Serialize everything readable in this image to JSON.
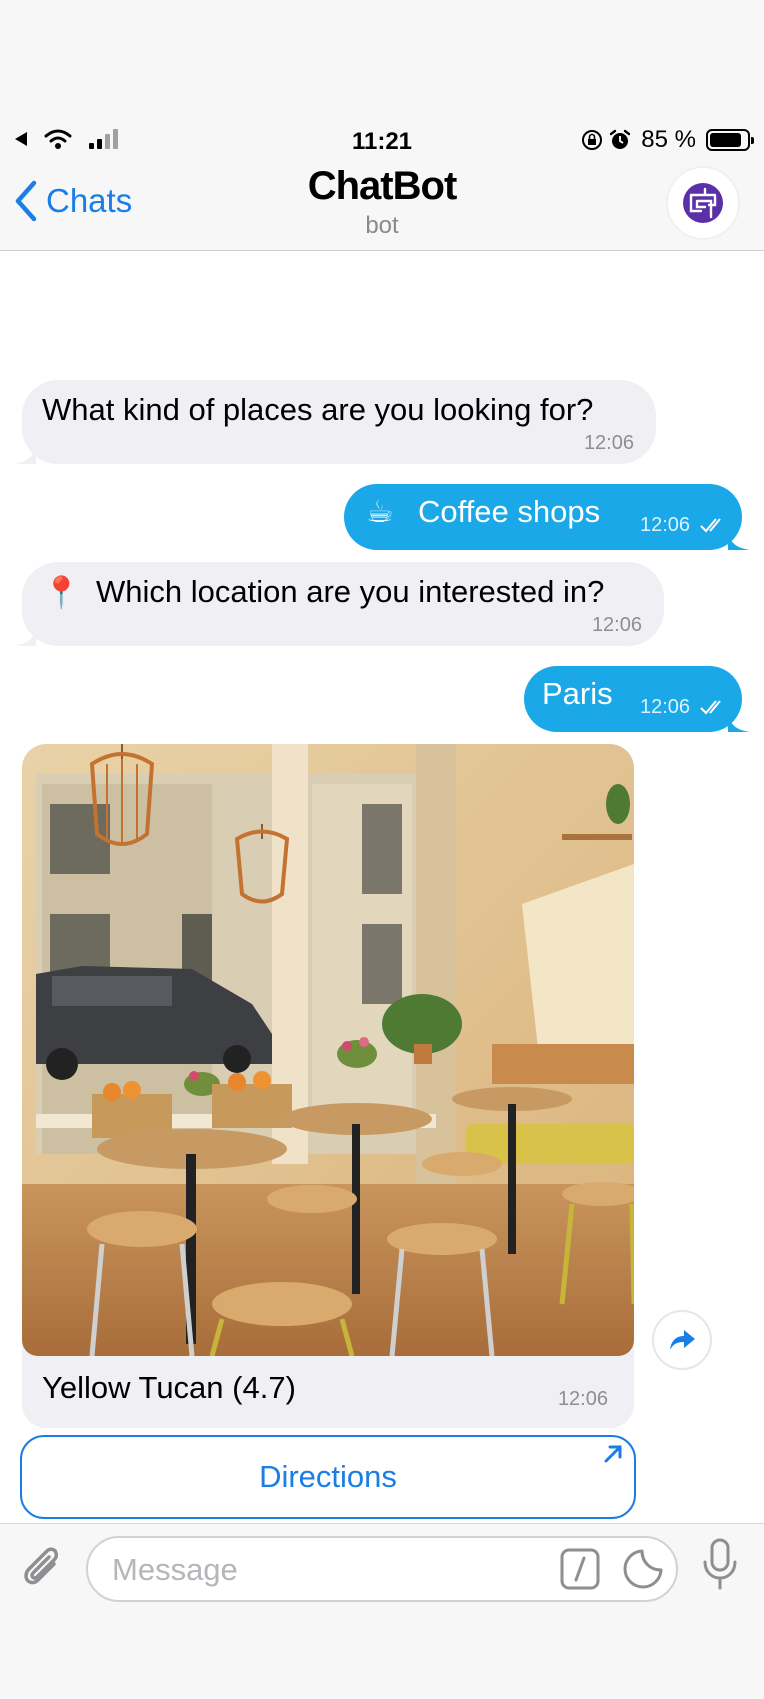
{
  "status_bar": {
    "time": "11:21",
    "battery_percent": "85 %"
  },
  "nav": {
    "back_label": "Chats",
    "title": "ChatBot",
    "subtitle": "bot"
  },
  "messages": [
    {
      "direction": "in",
      "text": "What kind of places are you looking for?",
      "time": "12:06"
    },
    {
      "direction": "out",
      "emoji": "☕",
      "text": "Coffee shops",
      "time": "12:06",
      "read": true
    },
    {
      "direction": "in",
      "emoji": "📍",
      "text": "Which location are you interested in?",
      "time": "12:06"
    },
    {
      "direction": "out",
      "text": "Paris",
      "time": "12:06",
      "read": true
    }
  ],
  "card": {
    "title": "Yellow Tucan (4.7)",
    "time": "12:06",
    "button_label": "Directions"
  },
  "input": {
    "placeholder": "Message"
  },
  "colors": {
    "accent": "#1a7ee6",
    "outgoing_bubble": "#1aa8e8",
    "incoming_bubble": "#efeff4"
  },
  "icons": [
    "back-chevron-icon",
    "wifi-icon",
    "signal-icon",
    "orientation-lock-icon",
    "alarm-icon",
    "battery-icon",
    "bot-avatar-icon",
    "share-icon",
    "external-link-icon",
    "attach-icon",
    "command-icon",
    "sticker-icon",
    "microphone-icon"
  ]
}
